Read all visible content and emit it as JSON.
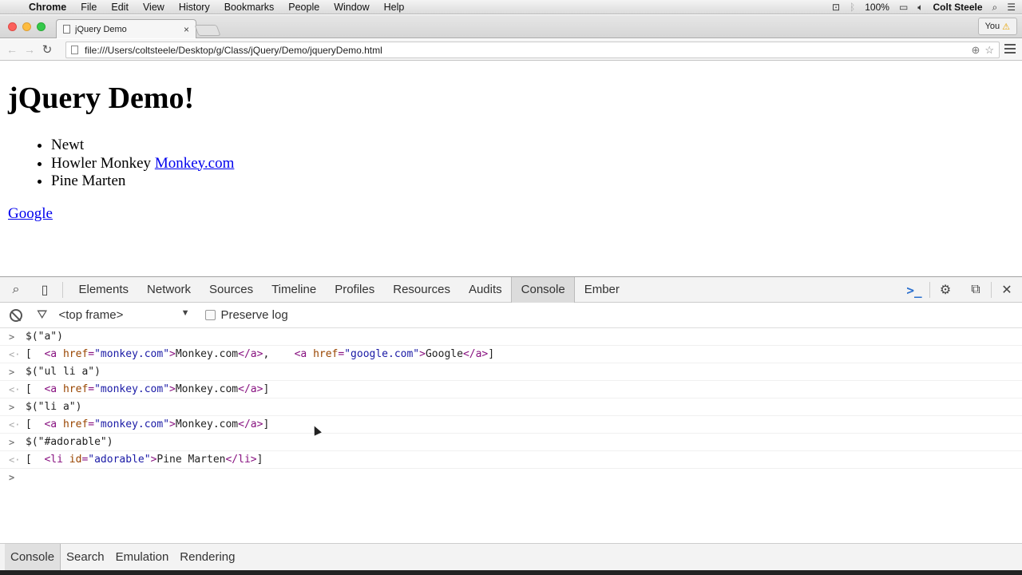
{
  "menubar": {
    "app": "Chrome",
    "items": [
      "File",
      "Edit",
      "View",
      "History",
      "Bookmarks",
      "People",
      "Window",
      "Help"
    ],
    "battery": "100%",
    "user": "Colt Steele"
  },
  "browser": {
    "tab_title": "jQuery Demo",
    "tab_close": "×",
    "profile": "You",
    "url": "file:///Users/coltsteele/Desktop/g/Class/jQuery/Demo/jqueryDemo.html"
  },
  "page": {
    "heading": "jQuery Demo!",
    "list": {
      "item1": "Newt",
      "item2_text": "Howler Monkey ",
      "item2_link": "Monkey.com",
      "item3": "Pine Marten"
    },
    "google_link": "Google"
  },
  "devtools": {
    "tabs": [
      "Elements",
      "Network",
      "Sources",
      "Timeline",
      "Profiles",
      "Resources",
      "Audits",
      "Console",
      "Ember"
    ],
    "active_tab": "Console",
    "frame": "<top frame>",
    "preserve_log": "Preserve log"
  },
  "console": {
    "in1": "$(\"a\")",
    "in2": "$(\"ul li a\")",
    "in3": "$(\"li a\")",
    "in4": "$(\"#adorable\")",
    "out_open": "[  ",
    "out_close": "]",
    "tag_a_open": "<a",
    "attr_href": " href",
    "eq": "=",
    "val_monkey": "\"monkey.com\"",
    "val_google": "\"google.com\"",
    "gt": ">",
    "txt_monkey": "Monkey.com",
    "txt_google": "Google",
    "tag_a_close": "</a>",
    "comma": ",    ",
    "tag_li_open": "<li",
    "attr_id": " id",
    "val_adorable": "\"adorable\"",
    "txt_pine": "Pine Marten",
    "tag_li_close": "</li>"
  },
  "drawer": {
    "tabs": [
      "Console",
      "Search",
      "Emulation",
      "Rendering"
    ]
  },
  "colors": {
    "link": "#0000ee",
    "tag": "#881280",
    "attr": "#994500",
    "value": "#1a1aa6",
    "accent": "#2a6fce"
  }
}
